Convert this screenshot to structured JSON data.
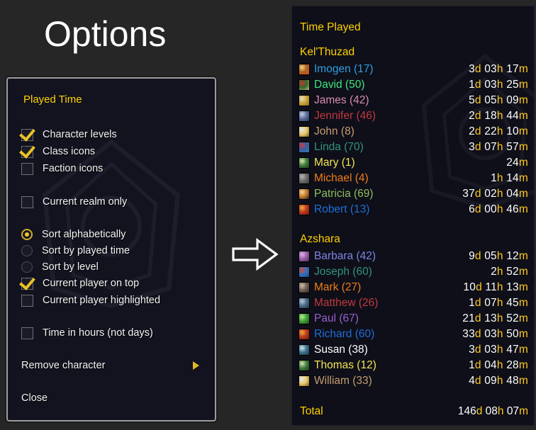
{
  "page": {
    "title": "Options",
    "background_color": "#262626"
  },
  "arrow": {
    "icon": "arrow-right-outline-icon"
  },
  "options_panel": {
    "title": "Played Time",
    "checkboxes": [
      {
        "label": "Character levels",
        "checked": true
      },
      {
        "label": "Class icons",
        "checked": true
      },
      {
        "label": "Faction icons",
        "checked": false
      },
      {
        "label": "Current realm only",
        "checked": false
      }
    ],
    "radios": [
      {
        "label": "Sort alphabetically",
        "selected": true
      },
      {
        "label": "Sort by played time",
        "selected": false
      },
      {
        "label": "Sort by level",
        "selected": false
      }
    ],
    "checkboxes2": [
      {
        "label": "Current player on top",
        "checked": true
      },
      {
        "label": "Current player highlighted",
        "checked": false
      }
    ],
    "checkboxes3": [
      {
        "label": "Time in hours (not days)",
        "checked": false
      }
    ],
    "menu_items": [
      {
        "label": "Remove character",
        "has_submenu": true
      },
      {
        "label": "Close",
        "has_submenu": false
      }
    ],
    "accent_color": "#ffd100",
    "check_color": "#e8c226"
  },
  "tooltip": {
    "title": "Time Played",
    "groups": [
      {
        "realm": "Kel'Thuzad",
        "characters": [
          {
            "name": "Imogen",
            "level": 17,
            "color": "#2f9fe0",
            "icon_colors": [
              "#a8601f",
              "#f0d080",
              "#d94b2b"
            ],
            "time": {
              "d": "3",
              "h": "03",
              "m": "17"
            }
          },
          {
            "name": "David",
            "level": 50,
            "color": "#3ce67e",
            "icon_colors": [
              "#2e6b33",
              "#c0392b",
              "#c8b27a"
            ],
            "time": {
              "d": "1",
              "h": "03",
              "m": "25"
            }
          },
          {
            "name": "James",
            "level": 42,
            "color": "#d98aae",
            "icon_colors": [
              "#c9a33c",
              "#e8dfc0",
              "#8a6a22"
            ],
            "time": {
              "d": "5",
              "h": "05",
              "m": "09"
            }
          },
          {
            "name": "Jennifer",
            "level": 46,
            "color": "#c2393f",
            "icon_colors": [
              "#5a6d9e",
              "#c8cde0",
              "#2d3550"
            ],
            "time": {
              "d": "2",
              "h": "18",
              "m": "44"
            }
          },
          {
            "name": "John",
            "level": 8,
            "color": "#c79c6e",
            "icon_colors": [
              "#e8c96a",
              "#dfe6ef",
              "#6b5420"
            ],
            "time": {
              "d": "2",
              "h": "22",
              "m": "10"
            }
          },
          {
            "name": "Linda",
            "level": 70,
            "color": "#33937f",
            "icon_colors": [
              "#2f5fa8",
              "#cf3d3d",
              "#3a7d9e"
            ],
            "time": {
              "d": "3",
              "h": "07",
              "m": "57"
            }
          },
          {
            "name": "Mary",
            "level": 1,
            "color": "#f2e355",
            "icon_colors": [
              "#3f7a3a",
              "#d8e8b0",
              "#1f3a1c"
            ],
            "time": {
              "d": "",
              "h": "",
              "m": "24"
            }
          },
          {
            "name": "Michael",
            "level": 4,
            "color": "#f07d18",
            "icon_colors": [
              "#6b6b6b",
              "#b5b5b5",
              "#3a3a3a"
            ],
            "time": {
              "d": "",
              "h": "1",
              "m": "14"
            }
          },
          {
            "name": "Patricia",
            "level": 69,
            "color": "#8fbf5f",
            "icon_colors": [
              "#c47a2a",
              "#f0d89a",
              "#1a1a1a"
            ],
            "time": {
              "d": "37",
              "h": "02",
              "m": "04"
            }
          },
          {
            "name": "Robert",
            "level": 13,
            "color": "#1f6fd6",
            "icon_colors": [
              "#b8381f",
              "#f0a83c",
              "#6b1a0d"
            ],
            "time": {
              "d": "6",
              "h": "00",
              "m": "46"
            }
          }
        ]
      },
      {
        "realm": "Azshara",
        "characters": [
          {
            "name": "Barbara",
            "level": 42,
            "color": "#7d85e0",
            "icon_colors": [
              "#9a5fa8",
              "#e0b0e8",
              "#4a2a55"
            ],
            "time": {
              "d": "9",
              "h": "05",
              "m": "12"
            }
          },
          {
            "name": "Joseph",
            "level": 60,
            "color": "#33937f",
            "icon_colors": [
              "#2f6fc0",
              "#d04a3a",
              "#1f4a80"
            ],
            "time": {
              "d": "",
              "h": "2",
              "m": "52"
            }
          },
          {
            "name": "Mark",
            "level": 27,
            "color": "#f07d18",
            "icon_colors": [
              "#6f6054",
              "#cfc0a8",
              "#2e2a24"
            ],
            "time": {
              "d": "10",
              "h": "11",
              "m": "13"
            }
          },
          {
            "name": "Matthew",
            "level": 26,
            "color": "#c2393f",
            "icon_colors": [
              "#4a6a8a",
              "#b8c8d8",
              "#22303f"
            ],
            "time": {
              "d": "1",
              "h": "07",
              "m": "45"
            }
          },
          {
            "name": "Paul",
            "level": 67,
            "color": "#9a5ecf",
            "icon_colors": [
              "#3f9e3a",
              "#b0f08a",
              "#1c4a18"
            ],
            "time": {
              "d": "21",
              "h": "13",
              "m": "52"
            }
          },
          {
            "name": "Richard",
            "level": 60,
            "color": "#1f6fd6",
            "icon_colors": [
              "#b8381f",
              "#f0a83c",
              "#6b1a0d"
            ],
            "time": {
              "d": "33",
              "h": "03",
              "m": "50"
            }
          },
          {
            "name": "Susan",
            "level": 38,
            "color": "#ffffff",
            "icon_colors": [
              "#3a6f8a",
              "#cfe8f0",
              "#1c3a4a"
            ],
            "time": {
              "d": "3",
              "h": "03",
              "m": "47"
            }
          },
          {
            "name": "Thomas",
            "level": 12,
            "color": "#f2e355",
            "icon_colors": [
              "#3f7a3a",
              "#d8e8b0",
              "#1f3a1c"
            ],
            "time": {
              "d": "1",
              "h": "04",
              "m": "28"
            }
          },
          {
            "name": "William",
            "level": 33,
            "color": "#c79c6e",
            "icon_colors": [
              "#e8c96a",
              "#dfe6ef",
              "#6b5420"
            ],
            "time": {
              "d": "4",
              "h": "09",
              "m": "48"
            }
          }
        ]
      }
    ],
    "total": {
      "label": "Total",
      "time": {
        "d": "146",
        "h": "08",
        "m": "07"
      }
    },
    "unit_color": "#ffc91e",
    "value_color": "#ffffff",
    "header_color": "#ffd100"
  }
}
